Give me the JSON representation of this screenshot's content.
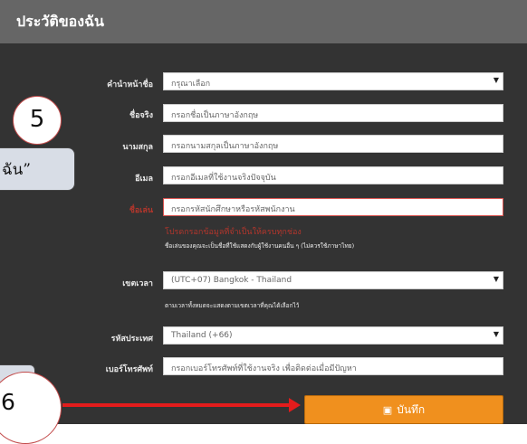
{
  "header": {
    "title": "ประวัติของฉัน"
  },
  "form": {
    "title_prefix": {
      "label": "คำนำหน้าชื่อ",
      "value": "กรุณาเลือก"
    },
    "first_name": {
      "label": "ชื่อจริง",
      "placeholder": "กรอกชื่อเป็นภาษาอังกฤษ"
    },
    "last_name": {
      "label": "นามสกุล",
      "placeholder": "กรอกนามสกุลเป็นภาษาอังกฤษ"
    },
    "email": {
      "label": "อีเมล",
      "placeholder": "กรอกอีเมลที่ใช้งานจริงปัจจุบัน"
    },
    "username": {
      "label": "ชื่อเล่น",
      "placeholder": "กรอกรหัสนักศึกษาหรือรหัสพนักงาน",
      "error": "โปรดกรอกข้อมูลที่จำเป็นให้ครบทุกช่อง",
      "note": "ชื่อเล่นของคุณจะเป็นชื่อที่ใช้แสดงกับผู้ใช้งานคนอื่น ๆ (ไม่ควรใช้ภาษาไทย)"
    },
    "timezone": {
      "label": "เขตเวลา",
      "value": "(UTC+07) Bangkok - Thailand",
      "note": "ตามเวลาทั้งหมดจะแสดงตามเขตเวลาที่คุณได้เลือกไว้"
    },
    "country_code": {
      "label": "รหัสประเทศ",
      "value": "Thailand (+66)"
    },
    "phone": {
      "label": "เบอร์โทรศัพท์",
      "placeholder": "กรอกเบอร์โทรศัพท์ที่ใช้งานจริง เพื่อติดต่อเมื่อมีปัญหา"
    },
    "save_label": "บันทึก"
  },
  "annotations": {
    "step5": "5",
    "step6": "6",
    "callout_text": "ฉัน”"
  },
  "colors": {
    "panel": "#333333",
    "header": "#666666",
    "button": "#f0901e",
    "error": "#b3362c",
    "arrow": "#e31c1c"
  }
}
